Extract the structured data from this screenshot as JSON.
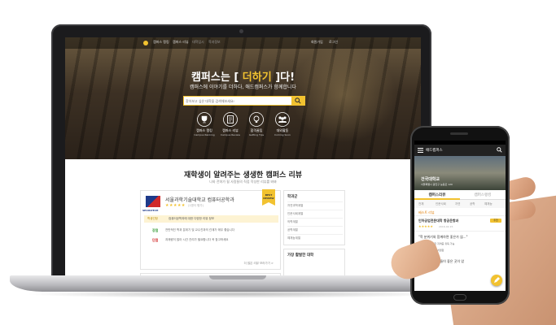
{
  "laptop": {
    "nav": {
      "items": [
        "캠퍼스 랭킹",
        "캠퍼스 리뷰",
        "대학입시",
        "학과정보"
      ],
      "right_items": [
        "회원가입",
        "로그인"
      ]
    },
    "hero": {
      "title_prefix": "캠퍼스는 [",
      "title_highlight": " 더하기 ",
      "title_suffix": "]다!",
      "subtitle": "캠퍼스에 이야기를 더하다, 애드캠퍼스가 함께합니다",
      "search_placeholder": "찾아보고 싶은 대학을 검색해보세요!"
    },
    "features": [
      {
        "label": "캠퍼스 랭킹",
        "desc": "Campus Ranking"
      },
      {
        "label": "캠퍼스 리뷰",
        "desc": "Campus Review"
      },
      {
        "label": "합격꿀팁",
        "desc": "Getting Tips"
      },
      {
        "label": "대외활동",
        "desc": "Coming Soon"
      }
    ],
    "review_section": {
      "title": "재학생이 알려주는 생생한 캠퍼스 리뷰",
      "subtitle": "나와 전혀가 될 사람들의 직접 작성한 리뷰를 봐봐"
    },
    "card": {
      "logo_caption": "SEOULTECH",
      "school": "서울과학기술대학교 컴퓨터공학과",
      "stars": "★★★★★",
      "stars_meta": "(1명이 평가)",
      "badge": "BEST REVIEW",
      "rank_label": "학생선정",
      "rank_value": "컴퓨터공학과에 대한 다양한 리뷰 정보",
      "pros_label": "장점",
      "pros_text": "전반적인 학과 분위기 및 교수진과의 관계가 매우 좋습니다",
      "cons_label": "단점",
      "cons_text": "과제량이 많아 시간 관리가 필요합니다 꼭 참고하세요",
      "more": "더 많은 리뷰 보러가기 >"
    },
    "sidebar": {
      "title": "학과군",
      "items": [
        "자연과학계열",
        "인문사회계열",
        "의학계열",
        "공학계열",
        "예체능계열"
      ],
      "second_title": "가장 활발한 대학"
    }
  },
  "phone": {
    "header_title": "애드캠퍼스",
    "hero_title": "건국대학교",
    "hero_sub": "서울특별시 광진구 능동로 120",
    "tabs": [
      "캠퍼스리뷰",
      "캠퍼스랭킹"
    ],
    "filters": [
      "전체",
      "인문사회",
      "자연",
      "공학",
      "예체능"
    ],
    "section_label": "베스트 리뷰",
    "school": "인하공업전문대학 항공운항과",
    "badge": "추천",
    "stars": "★★★★★",
    "date": "2016-02-15",
    "quote1": "\"학 분위기와 함께하면 좋은가 않...\"",
    "pros_label": "장점",
    "pros_text": "1.다양한 자격증 취득 가능",
    "cons_label": "단점",
    "cons_text": "1.경쟁이 치열함",
    "quote2": "\"학 분위기와 힘들이 좋은 곳이 었",
    "colors": {
      "accent": "#f2c230",
      "dark": "#222222",
      "pros": "#3a9d3a",
      "cons": "#d12a2a"
    }
  }
}
